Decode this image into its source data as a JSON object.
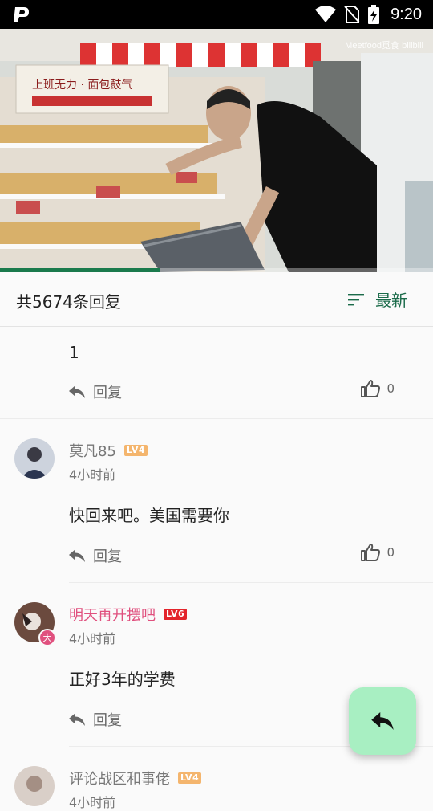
{
  "status_bar": {
    "time": "9:20",
    "icons": [
      "app-p-icon",
      "wifi-icon",
      "no-sim-icon",
      "battery-charging-icon"
    ]
  },
  "video": {
    "watermark": "Meetfood觅食 bilibili",
    "progress": 0.37,
    "sign_text": "上班无力 · 面包鼓气"
  },
  "sort_bar": {
    "count_label": "共5674条回复",
    "sort_label": "最新"
  },
  "comments": [
    {
      "content": "1",
      "reply_label": "回复",
      "likes": "0"
    },
    {
      "author": "莫凡85",
      "level": "LV4",
      "time": "4小时前",
      "content": "快回来吧。美国需要你",
      "reply_label": "回复",
      "likes": "0"
    },
    {
      "author": "明天再开摆吧",
      "level": "LV6",
      "time": "4小时前",
      "content": "正好3年的学费",
      "reply_label": "回复",
      "badge": "大"
    },
    {
      "author": "评论战区和事佬",
      "level": "LV4",
      "time": "4小时前"
    }
  ],
  "colors": {
    "accent": "#1b6b4a",
    "fab": "#a8efc2",
    "vip_name": "#e0507e"
  }
}
